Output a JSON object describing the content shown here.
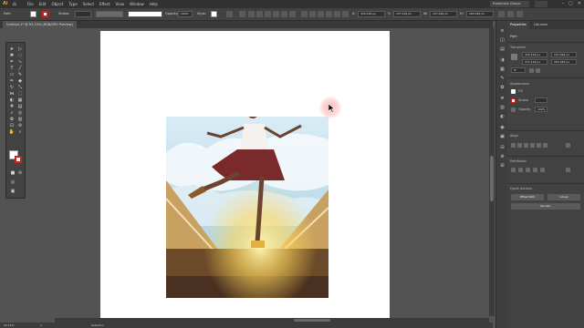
{
  "app": {
    "logo": "Ai",
    "workspace": "Essentials Classic"
  },
  "menu": [
    "File",
    "Edit",
    "Object",
    "Type",
    "Select",
    "Effect",
    "View",
    "Window",
    "Help"
  ],
  "control_bar": {
    "selection_label": "Path",
    "stroke_label": "Stroke:",
    "opacity_label": "Opacity:",
    "opacity_value": "100%",
    "style_label": "Style:",
    "x_value": "326.226 px",
    "y_value": "237.126 px",
    "w_value": "197.094 px",
    "h_value": "265.065 px"
  },
  "document_tab": {
    "title": "Untitled-1* @ 93.12% (RGB/GPU Preview)"
  },
  "status_bar": {
    "zoom": "93.12%",
    "page": "1",
    "tool": "Selection"
  },
  "panel": {
    "tabs": [
      "Properties",
      "Libraries"
    ],
    "selection_type": "Path",
    "transform": {
      "title": "Transform",
      "x": "326.226 px",
      "y": "237.126 px",
      "w": "197.094 px",
      "h": "265.065 px",
      "rotate": "0°"
    },
    "appearance": {
      "title": "Appearance",
      "fill_label": "Fill",
      "stroke_label": "Stroke",
      "opacity_label": "Opacity",
      "opacity_value": "100%"
    },
    "align_title": "Align",
    "pathfinder_title": "Pathfinder",
    "quick_actions": {
      "title": "Quick Actions",
      "offset_path": "Offset Path",
      "group": "Group",
      "recolor": "Recolor"
    }
  },
  "colors": {
    "accent_orange": "#ff9a00",
    "stroke_red": "#d02020",
    "canvas_bg": "#535353"
  },
  "icons": {
    "tools": [
      "selection-arrow",
      "direct-selection",
      "magic-wand",
      "lasso",
      "pen",
      "curvature",
      "type",
      "line",
      "rectangle",
      "paintbrush",
      "pencil",
      "eraser",
      "rotate",
      "scale",
      "width",
      "free-transform",
      "shape-builder",
      "perspective",
      "mesh",
      "gradient",
      "eyedropper",
      "blend",
      "symbol-sprayer",
      "column-graph",
      "artboard",
      "slice",
      "hand",
      "zoom"
    ]
  }
}
